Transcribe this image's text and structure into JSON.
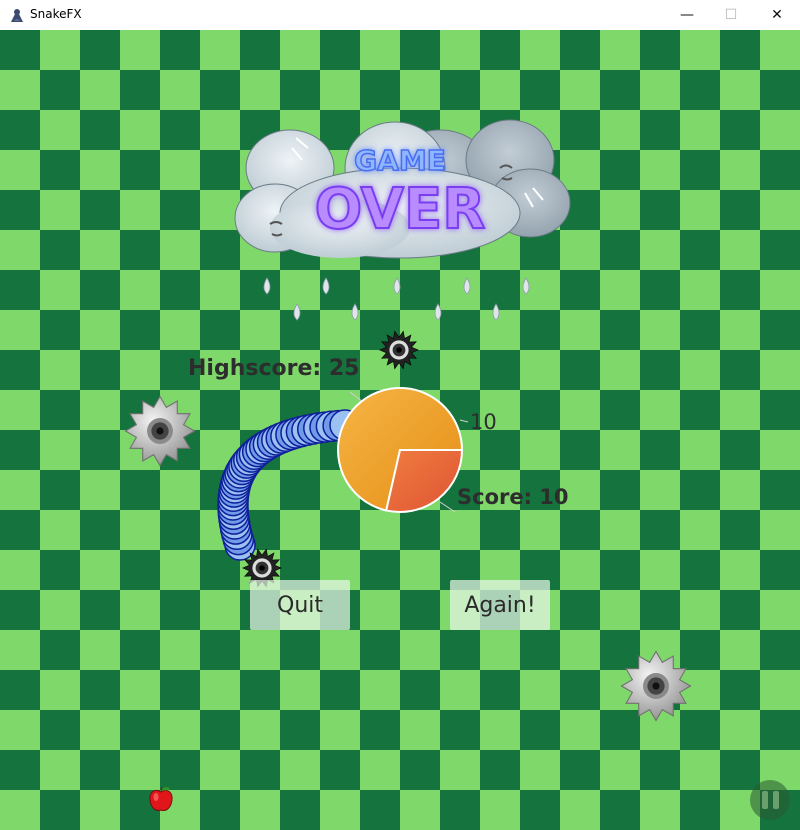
{
  "window": {
    "title": "SnakeFX",
    "minimize_glyph": "—",
    "maximize_glyph": "☐",
    "close_glyph": "✕"
  },
  "logo": {
    "line1": "GAME",
    "line2": "OVER"
  },
  "scores": {
    "highscore_text": "Highscore: 25",
    "score_text": "Score: 10",
    "pie_value_label": "10"
  },
  "chart_data": {
    "type": "pie",
    "values": [
      25,
      10
    ],
    "colors": [
      "#f0a02a",
      "#e8643a"
    ]
  },
  "buttons": {
    "quit_label": "Quit",
    "again_label": "Again!"
  },
  "icons": {
    "app": "snake-icon",
    "hazards": "saw-blade-icon",
    "food": "apple-icon",
    "pause": "pause-icon"
  },
  "colors": {
    "board_dark": "#15733e",
    "board_light": "#7fd96a",
    "snake_dark": "#0f1f9a",
    "snake_light": "#9bc0f2"
  }
}
